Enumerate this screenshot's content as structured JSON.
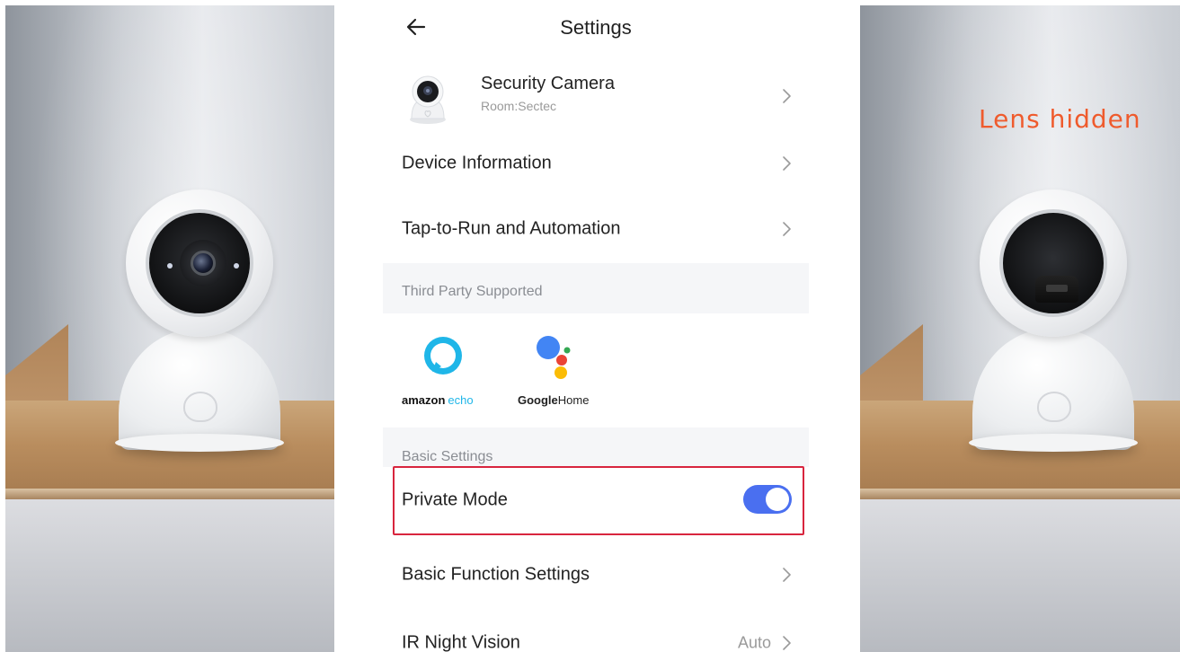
{
  "settings": {
    "title": "Settings",
    "device": {
      "name": "Security Camera",
      "room": "Room:Sectec"
    },
    "rows": {
      "device_information": "Device Information",
      "tap_to_run": "Tap-to-Run and Automation",
      "private_mode": "Private Mode",
      "basic_function_settings": "Basic Function Settings",
      "ir_night_vision": "IR Night Vision",
      "ir_night_vision_value": "Auto"
    },
    "sections": {
      "third_party": "Third Party Supported",
      "basic_settings": "Basic Settings"
    },
    "integrations": {
      "alexa_brand": "amazon",
      "alexa_product": "echo",
      "google_brand": "Google",
      "google_product": "Home"
    },
    "private_mode_enabled": true
  },
  "caption": {
    "lens_hidden": "Lens hidden"
  },
  "colors": {
    "accent_toggle": "#4a6ff0",
    "highlight_border": "#d8253e",
    "caption": "#ef5b2d",
    "alexa_blue": "#1fb6e8"
  },
  "icons": [
    "back-arrow-icon",
    "chevron-right-icon",
    "alexa-ring-icon",
    "google-assistant-icon"
  ]
}
